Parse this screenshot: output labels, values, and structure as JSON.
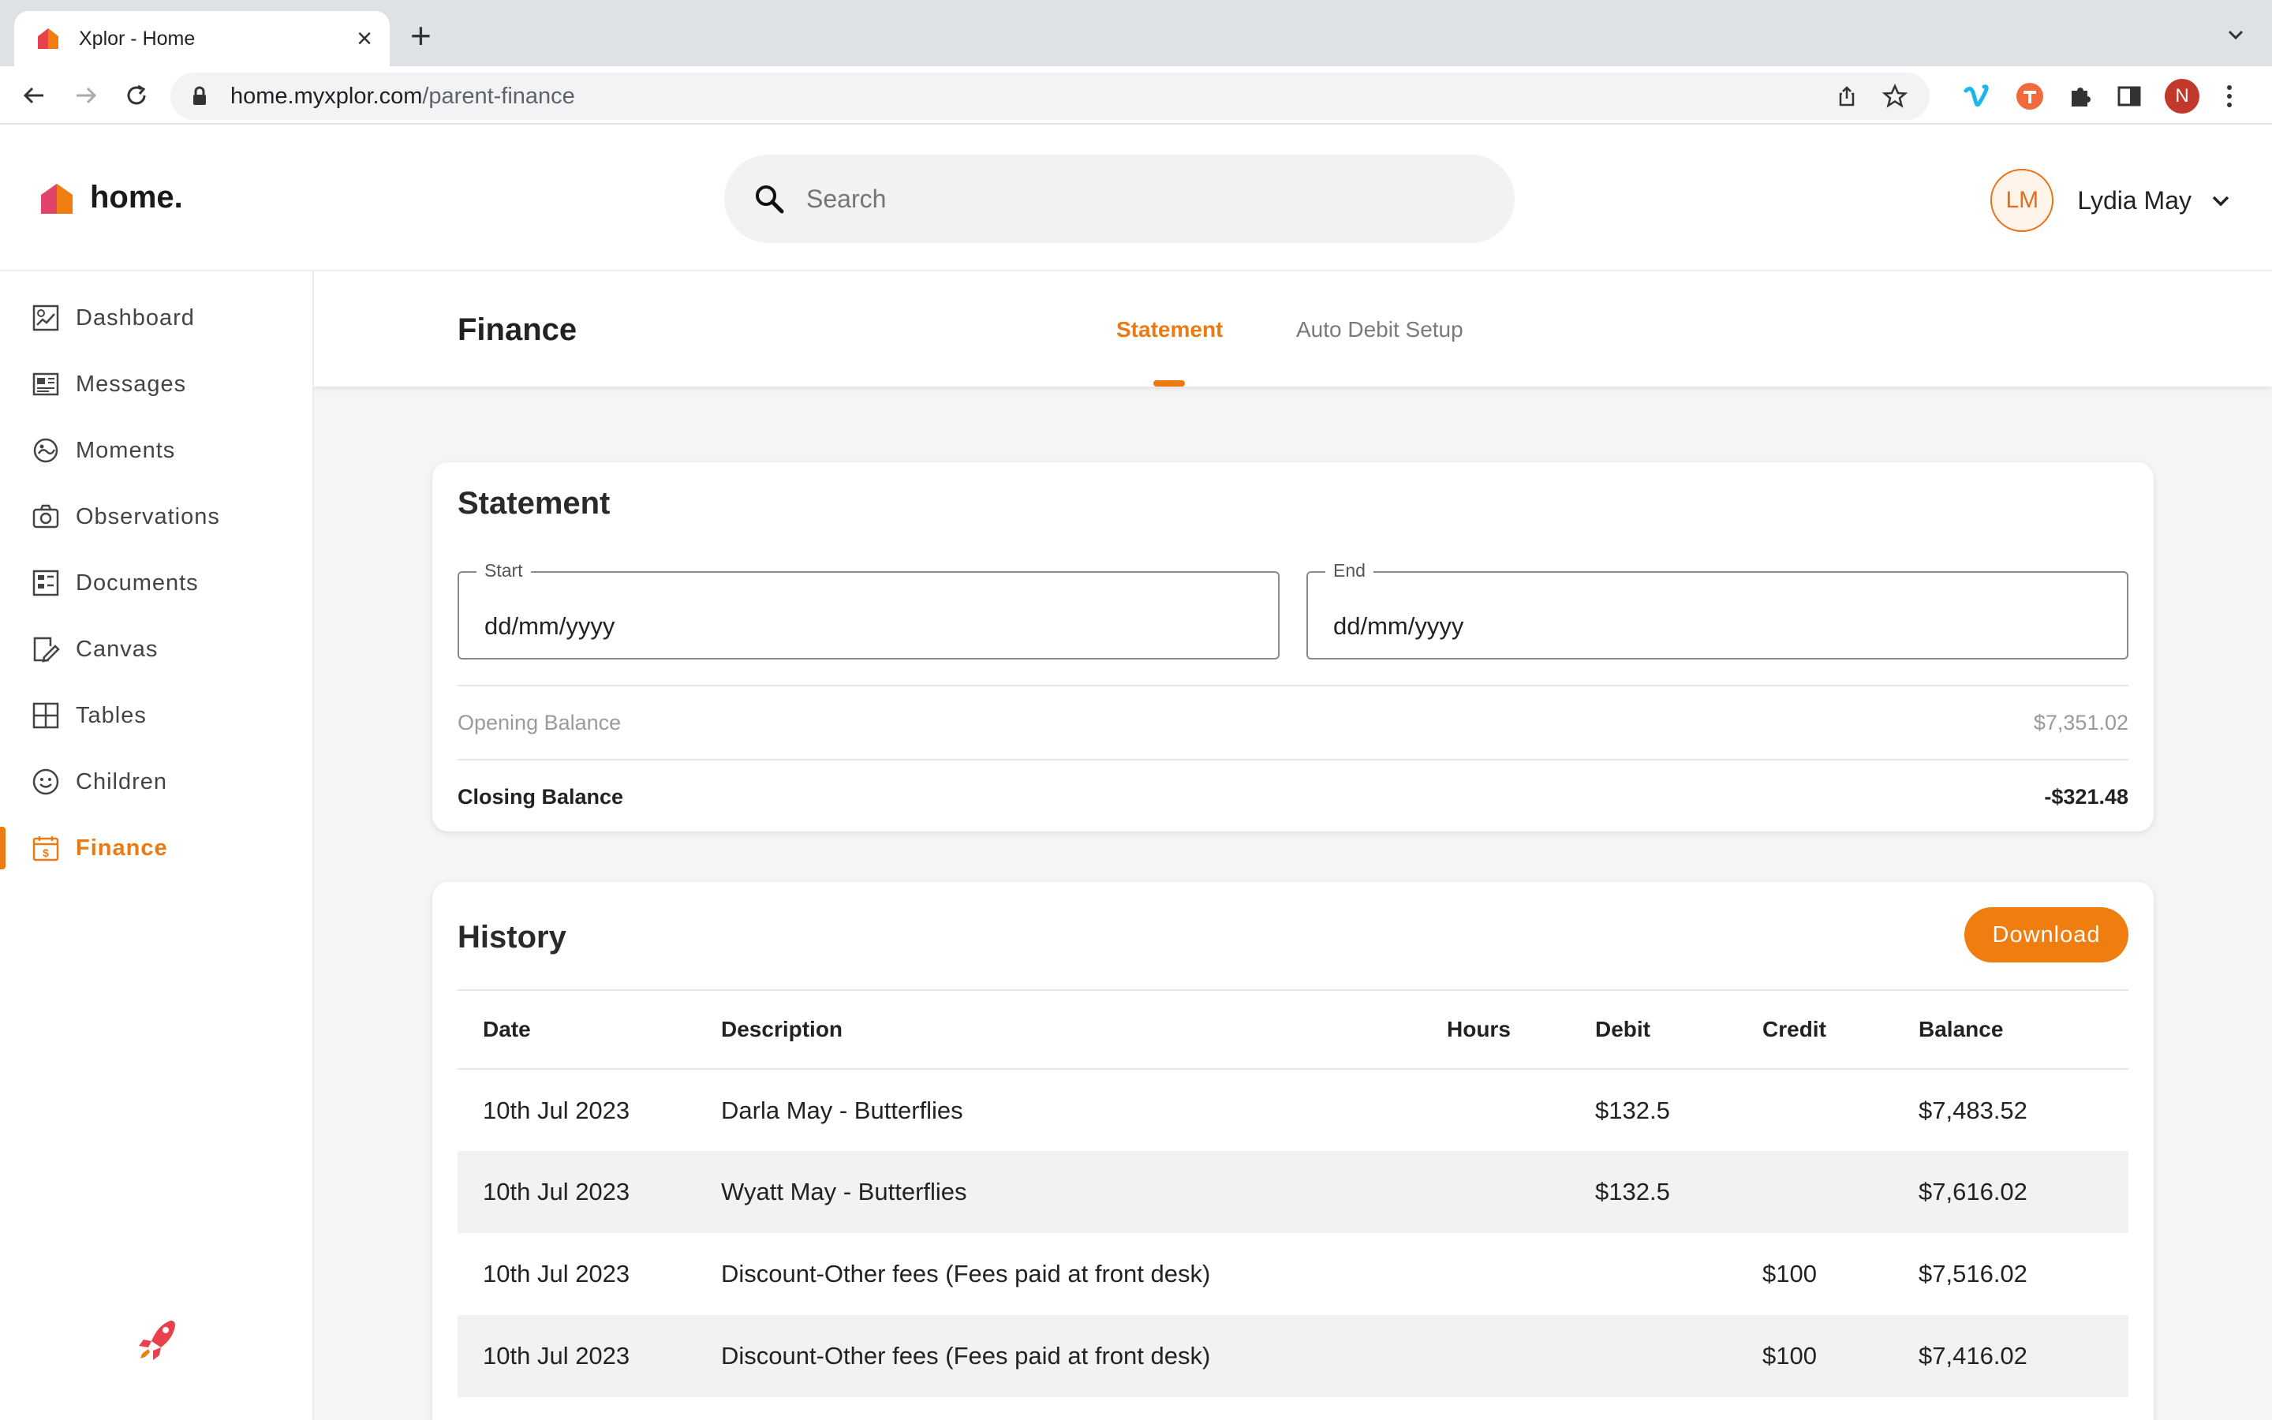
{
  "browser": {
    "tab_title": "Xplor - Home",
    "tab_close": "×",
    "new_tab": "+",
    "url_host": "home.myxplor.com",
    "url_path": "/parent-finance",
    "profile_initial": "N"
  },
  "header": {
    "logo_text": "home.",
    "search_placeholder": "Search",
    "user_initials": "LM",
    "user_name": "Lydia May"
  },
  "sidebar": {
    "items": [
      {
        "label": "Dashboard",
        "icon": "dashboard-icon"
      },
      {
        "label": "Messages",
        "icon": "messages-icon"
      },
      {
        "label": "Moments",
        "icon": "moments-icon"
      },
      {
        "label": "Observations",
        "icon": "camera-icon"
      },
      {
        "label": "Documents",
        "icon": "documents-icon"
      },
      {
        "label": "Canvas",
        "icon": "canvas-icon"
      },
      {
        "label": "Tables",
        "icon": "tables-icon"
      },
      {
        "label": "Children",
        "icon": "children-icon"
      },
      {
        "label": "Finance",
        "icon": "finance-icon",
        "active": true
      }
    ]
  },
  "finance": {
    "title": "Finance",
    "tabs": [
      {
        "label": "Statement",
        "active": true
      },
      {
        "label": "Auto Debit Setup",
        "active": false
      }
    ]
  },
  "statement": {
    "title": "Statement",
    "start_label": "Start",
    "start_placeholder": "dd/mm/yyyy",
    "end_label": "End",
    "end_placeholder": "dd/mm/yyyy",
    "opening_label": "Opening Balance",
    "opening_value": "$7,351.02",
    "closing_label": "Closing Balance",
    "closing_value": "-$321.48"
  },
  "history": {
    "title": "History",
    "download_label": "Download",
    "columns": [
      "Date",
      "Description",
      "Hours",
      "Debit",
      "Credit",
      "Balance"
    ],
    "rows": [
      {
        "date": "10th Jul 2023",
        "description": "Darla May - Butterflies",
        "hours": "",
        "debit": "$132.5",
        "credit": "",
        "balance": "$7,483.52"
      },
      {
        "date": "10th Jul 2023",
        "description": "Wyatt May - Butterflies",
        "hours": "",
        "debit": "$132.5",
        "credit": "",
        "balance": "$7,616.02"
      },
      {
        "date": "10th Jul 2023",
        "description": "Discount-Other fees (Fees paid at front desk)",
        "hours": "",
        "debit": "",
        "credit": "$100",
        "balance": "$7,516.02"
      },
      {
        "date": "10th Jul 2023",
        "description": "Discount-Other fees (Fees paid at front desk)",
        "hours": "",
        "debit": "",
        "credit": "$100",
        "balance": "$7,416.02"
      }
    ]
  },
  "colors": {
    "accent": "#EC7A12",
    "button": "#F07D10"
  }
}
